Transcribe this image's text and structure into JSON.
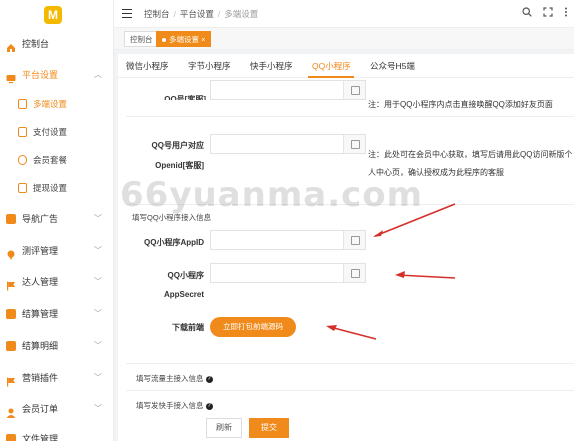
{
  "brand": {
    "logo_letter": "M",
    "accent": "#f08a1a"
  },
  "sidebar": {
    "items": [
      {
        "label": "控制台",
        "icon": "home-icon"
      },
      {
        "label": "平台设置",
        "icon": "monitor-icon",
        "expanded": true
      },
      {
        "label": "导航广告",
        "icon": "grid-icon"
      },
      {
        "label": "测评管理",
        "icon": "pin-icon"
      },
      {
        "label": "达人管理",
        "icon": "flag-icon"
      },
      {
        "label": "结算管理",
        "icon": "box-icon"
      },
      {
        "label": "结算明细",
        "icon": "box-icon"
      },
      {
        "label": "营销插件",
        "icon": "flag-icon"
      },
      {
        "label": "会员订单",
        "icon": "user-icon"
      },
      {
        "label": "文件管理",
        "icon": "file-icon"
      }
    ],
    "sub_items": [
      {
        "label": "多端设置",
        "active": true
      },
      {
        "label": "支付设置"
      },
      {
        "label": "会员套餐"
      },
      {
        "label": "提现设置"
      }
    ]
  },
  "header": {
    "breadcrumb": [
      "控制台",
      "平台设置",
      "多端设置"
    ]
  },
  "page_tabs": [
    {
      "label": "控制台"
    },
    {
      "label": "多端设置",
      "active": true,
      "close": "×"
    }
  ],
  "tabs": [
    {
      "label": "微信小程序"
    },
    {
      "label": "字节小程序"
    },
    {
      "label": "快手小程序"
    },
    {
      "label": "QQ小程序",
      "active": true
    },
    {
      "label": "公众号H5端"
    }
  ],
  "form": {
    "top_field_label": "QQ号[客服]",
    "top_note": "注：用于QQ小程序内点击直接唤醒QQ添加好友页面",
    "openid_label_line1": "QQ号用户对应",
    "openid_label_line2": "Openid[客服]",
    "openid_note_line1": "注：此处可在会员中心获取，填写后请用此QQ访问新版个",
    "openid_note_line2": "人中心页，确认授权成为此程序的客服",
    "section_title": "填写QQ小程序接入信息",
    "appid_label": "QQ小程序AppID",
    "appsecret_label_line1": "QQ小程序",
    "appsecret_label_line2": "AppSecret",
    "download_label": "下载前端",
    "download_button": "立即打包前端源码",
    "liuliang_title": "填写流量主接入信息",
    "kuaishou_title": "填写发快手接入信息",
    "refresh_button": "刷新",
    "submit_button": "提交"
  },
  "watermark": "66yuanma.com"
}
